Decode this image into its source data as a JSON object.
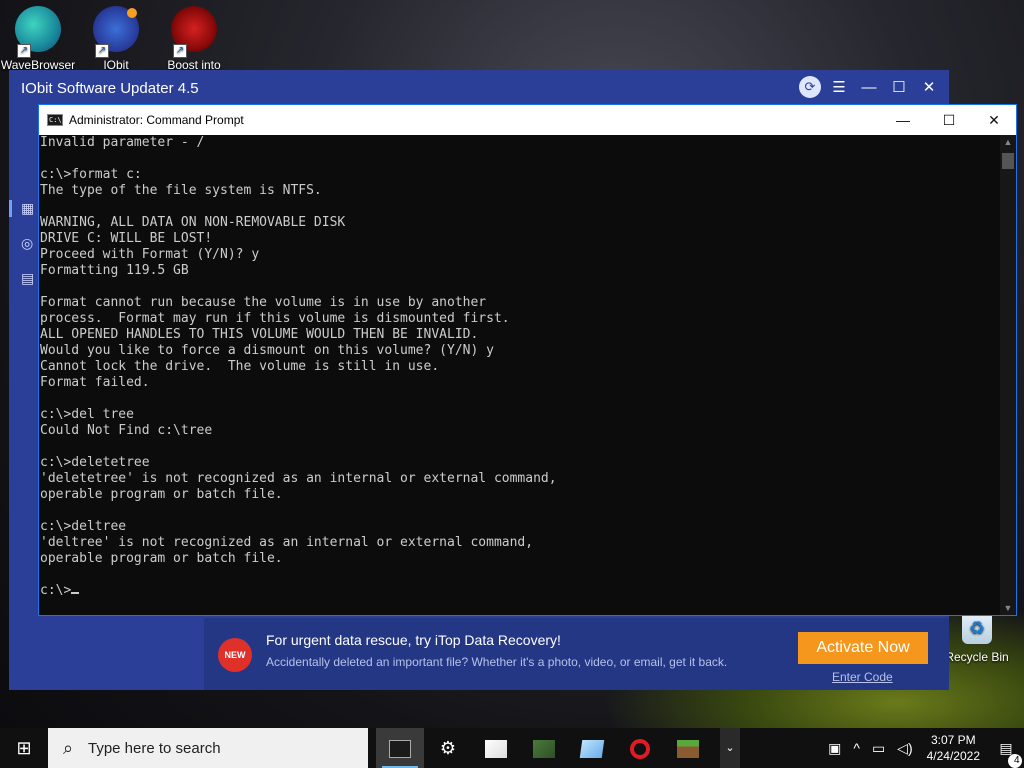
{
  "desktop": {
    "icons": [
      {
        "label": "WaveBrowser",
        "icon": "wavebrowser-icon"
      },
      {
        "label": "IObit",
        "icon": "iobit-icon"
      },
      {
        "label": "Boost into",
        "icon": "boost-icon"
      }
    ],
    "recycle_bin": "Recycle Bin"
  },
  "iobit": {
    "title": "IObit Software Updater 4.5",
    "promo": {
      "badge": "NEW",
      "headline": "For urgent data rescue, try iTop Data Recovery!",
      "subtext": "Accidentally deleted an important file? Whether it's a photo, video, or email, get it back.",
      "activate": "Activate Now",
      "enter_code": "Enter Code"
    }
  },
  "cmd": {
    "title": "Administrator: Command Prompt",
    "lines": [
      "Invalid parameter - /",
      "",
      "c:\\>format c:",
      "The type of the file system is NTFS.",
      "",
      "WARNING, ALL DATA ON NON-REMOVABLE DISK",
      "DRIVE C: WILL BE LOST!",
      "Proceed with Format (Y/N)? y",
      "Formatting 119.5 GB",
      "",
      "Format cannot run because the volume is in use by another",
      "process.  Format may run if this volume is dismounted first.",
      "ALL OPENED HANDLES TO THIS VOLUME WOULD THEN BE INVALID.",
      "Would you like to force a dismount on this volume? (Y/N) y",
      "Cannot lock the drive.  The volume is still in use.",
      "Format failed.",
      "",
      "c:\\>del tree",
      "Could Not Find c:\\tree",
      "",
      "c:\\>deletetree",
      "'deletetree' is not recognized as an internal or external command,",
      "operable program or batch file.",
      "",
      "c:\\>deltree",
      "'deltree' is not recognized as an internal or external command,",
      "operable program or batch file.",
      "",
      "c:\\>"
    ]
  },
  "taskbar": {
    "search_placeholder": "Type here to search",
    "time": "3:07 PM",
    "date": "4/24/2022",
    "notification_count": "4"
  }
}
